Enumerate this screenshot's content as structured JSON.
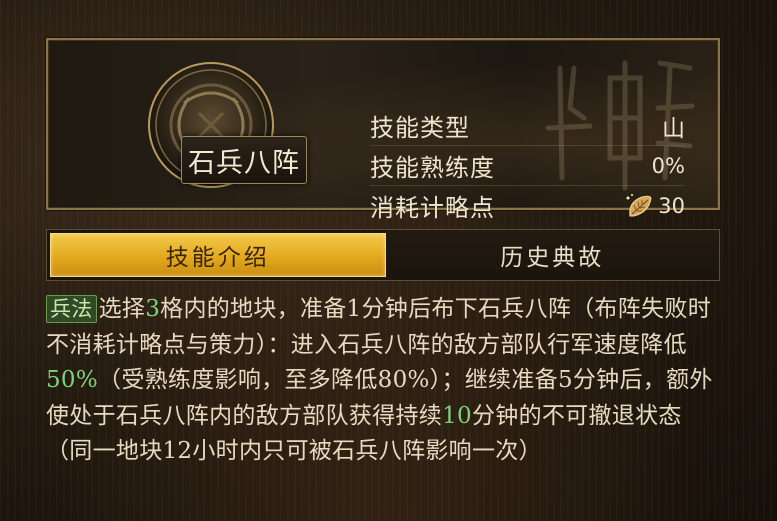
{
  "skill": {
    "name": "石兵八阵",
    "stats": [
      {
        "label": "技能类型",
        "value": "山"
      },
      {
        "label": "技能熟练度",
        "value": "0%"
      },
      {
        "label": "消耗计略点",
        "value": "30",
        "icon": "leaf-icon"
      }
    ]
  },
  "tabs": [
    {
      "label": "技能介绍",
      "active": true
    },
    {
      "label": "历史典故",
      "active": false
    }
  ],
  "description": {
    "tag": "兵法",
    "segments": [
      "选择",
      "3",
      "格内的地块，准备1分钟后布下石兵八阵（布阵失败时不消耗计略点与策力）：进入石兵八阵的敌方部队行军速度降低",
      "50%",
      "（受熟练度影响，至多降低80%）；继续准备5分钟后，额外使处于石兵八阵内的敌方部队获得持续",
      "10",
      "分钟的不可撤退状态（同一地块12小时内只可被石兵八阵影响一次）"
    ]
  },
  "colors": {
    "gold_tab": "#e2a91f",
    "highlight_green": "#7ed37a",
    "tag_green": "#2f4a26",
    "border_gold": "#8b7446"
  }
}
